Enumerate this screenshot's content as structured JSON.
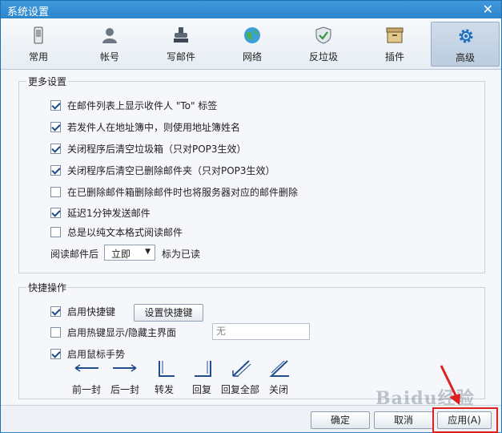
{
  "window": {
    "title": "系统设置",
    "close_glyph": "✕"
  },
  "tabs": [
    {
      "label": "常用",
      "icon": "phone-icon"
    },
    {
      "label": "帐号",
      "icon": "user-icon"
    },
    {
      "label": "写邮件",
      "icon": "stamp-icon"
    },
    {
      "label": "网络",
      "icon": "globe-icon"
    },
    {
      "label": "反垃圾",
      "icon": "shield-icon"
    },
    {
      "label": "插件",
      "icon": "box-icon"
    },
    {
      "label": "高级",
      "icon": "gear-icon",
      "active": true
    }
  ],
  "more_settings": {
    "title": "更多设置",
    "options": [
      {
        "label": "在邮件列表上显示收件人 \"To\" 标签",
        "checked": true
      },
      {
        "label": "若发件人在地址簿中，则使用地址簿姓名",
        "checked": true
      },
      {
        "label": "关闭程序后清空垃圾箱（只对POP3生效）",
        "checked": true
      },
      {
        "label": "关闭程序后清空已删除邮件夹（只对POP3生效）",
        "checked": true
      },
      {
        "label": "在已删除邮件箱删除邮件时也将服务器对应的邮件删除",
        "checked": false
      },
      {
        "label": "延迟1分钟发送邮件",
        "checked": true
      },
      {
        "label": "总是以纯文本格式阅读邮件",
        "checked": false
      }
    ],
    "read_prefix": "阅读邮件后",
    "read_select": "立即",
    "read_suffix": "标为已读"
  },
  "shortcuts": {
    "title": "快捷操作",
    "enable_hotkeys": {
      "label": "启用快捷键",
      "checked": true
    },
    "set_hotkeys_button": "设置快捷键",
    "hotkey_toggle": {
      "label": "启用热键显示/隐藏主界面",
      "checked": false
    },
    "hotkey_input": "无",
    "mouse_gesture": {
      "label": "启用鼠标手势",
      "checked": true
    },
    "gestures": [
      "前一封",
      "后一封",
      "转发",
      "回复",
      "回复全部",
      "关闭"
    ]
  },
  "footer": {
    "ok": "确定",
    "cancel": "取消",
    "apply": "应用(A)"
  },
  "watermark": "Baidu经验",
  "colors": {
    "title_bar": "#2c86cc",
    "highlight": "#e02020",
    "check": "#1a4c8c"
  }
}
